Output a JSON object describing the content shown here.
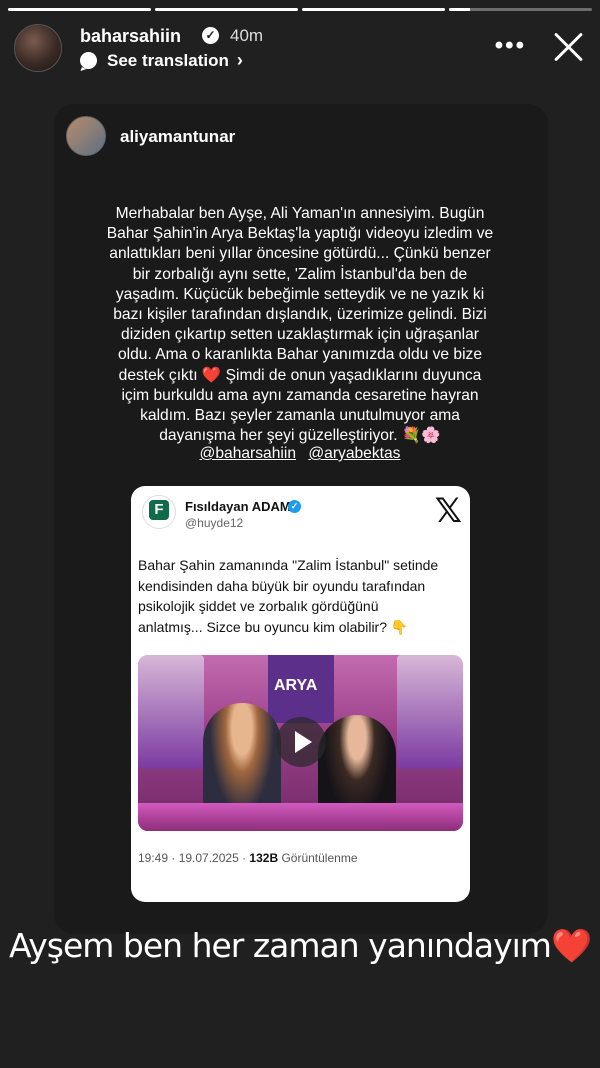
{
  "story": {
    "progress_segments": [
      1,
      1,
      1,
      0.15
    ],
    "username": "baharsahiin",
    "time": "40m",
    "see_translation": "See translation",
    "more_label": "•••"
  },
  "repost": {
    "username": "aliyamantunar",
    "text_lines": [
      "Merhabalar ben Ayşe, Ali Yaman'ın annesiyim. Bugün",
      "Bahar Şahin'in Arya Bektaş'la yaptığı videoyu izledim ve",
      "anlattıkları beni yıllar öncesine götürdü... Çünkü benzer",
      "bir zorbalığı aynı sette, 'Zalim İstanbul'da ben de",
      "yaşadım. Küçücük bebeğimle setteydik ve ne yazık ki",
      "bazı kişiler tarafından dışlandık, üzerimize gelindi. Bizi",
      "diziden çıkartıp setten uzaklaştırmak için uğraşanlar",
      "oldu. Ama o karanlıkta Bahar yanımızda oldu ve bize",
      "destek çıktı ❤️ Şimdi de onun yaşadıklarını duyunca",
      "içim burkuldu ama aynı zamanda cesaretine hayran",
      "kaldım. Bazı şeyler zamanla unutulmuyor ama",
      "dayanışma her şeyi güzelleştiriyor. 💐🌸"
    ],
    "mentions": [
      "@baharsahiin",
      "@aryabektas"
    ]
  },
  "tweet": {
    "name": "Fısıldayan ADAM",
    "handle": "@huyde12",
    "x_logo": "𝕏",
    "text_lines": [
      "Bahar Şahin zamanında \"Zalim İstanbul\" setinde",
      "kendisinden daha büyük bir oyundu tarafından",
      "psikolojik şiddet ve zorbalık gördüğünü",
      "anlatmış... Sizce bu oyuncu kim olabilir? 👇"
    ],
    "video_sign": "ARYA",
    "meta_time": "19:49 · 19.07.2025 · ",
    "meta_views": "132B",
    "meta_views_label": " Görüntülenme"
  },
  "caption": {
    "text": "Ayşem ben her zaman yanındayım",
    "emoji": "❤️"
  }
}
